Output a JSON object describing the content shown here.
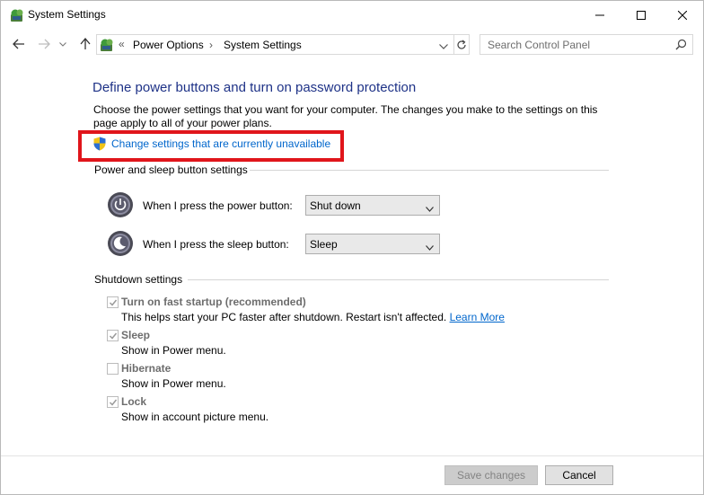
{
  "window": {
    "title": "System Settings",
    "icon": "control-panel-icon"
  },
  "titlebar_buttons": [
    "minimize-icon",
    "maximize-icon",
    "close-icon"
  ],
  "address_bar": {
    "separator": "«",
    "crumbs": [
      "Power Options",
      "System Settings"
    ],
    "crumb_separator": "›"
  },
  "search": {
    "placeholder": "Search Control Panel"
  },
  "page": {
    "heading": "Define power buttons and turn on password protection",
    "description": "Choose the power settings that you want for your computer. The changes you make to the settings on this page apply to all of your power plans.",
    "change_link": "Change settings that are currently unavailable"
  },
  "power_sleep": {
    "section_title": "Power and sleep button settings",
    "rows": [
      {
        "label": "When I press the power button:",
        "value": "Shut down",
        "icon": "power-button-icon"
      },
      {
        "label": "When I press the sleep button:",
        "value": "Sleep",
        "icon": "sleep-button-icon"
      }
    ]
  },
  "shutdown": {
    "section_title": "Shutdown settings",
    "options": [
      {
        "title": "Turn on fast startup (recommended)",
        "desc": "This helps start your PC faster after shutdown. Restart isn't affected.",
        "link": "Learn More",
        "checked": true
      },
      {
        "title": "Sleep",
        "desc": "Show in Power menu.",
        "checked": true
      },
      {
        "title": "Hibernate",
        "desc": "Show in Power menu.",
        "checked": false
      },
      {
        "title": "Lock",
        "desc": "Show in account picture menu.",
        "checked": true
      }
    ]
  },
  "footer": {
    "save_label": "Save changes",
    "cancel_label": "Cancel"
  },
  "colors": {
    "heading": "#1e3287",
    "link": "#0066cc",
    "highlight_border": "#e0151b"
  }
}
